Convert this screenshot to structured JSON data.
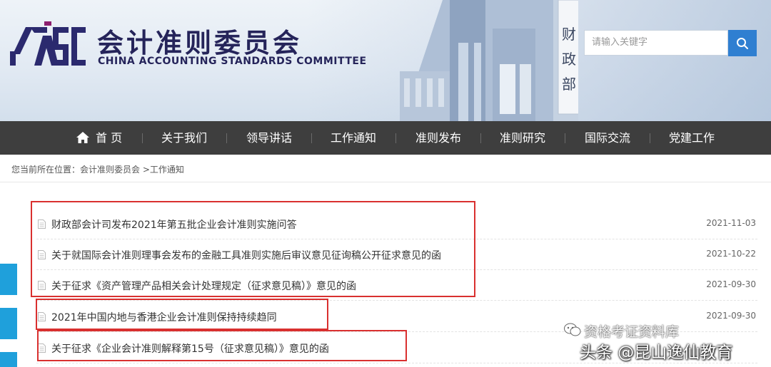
{
  "header": {
    "logo_text": "CASC",
    "title_cn": "会计准则委员会",
    "title_en": "CHINA ACCOUNTING STANDARDS COMMITTEE",
    "building_sign": "财政部"
  },
  "search": {
    "placeholder": "请输入关键字"
  },
  "nav": {
    "items": [
      {
        "label": "首 页"
      },
      {
        "label": "关于我们"
      },
      {
        "label": "领导讲话"
      },
      {
        "label": "工作通知"
      },
      {
        "label": "准则发布"
      },
      {
        "label": "准则研究"
      },
      {
        "label": "国际交流"
      },
      {
        "label": "党建工作"
      }
    ]
  },
  "breadcrumb": {
    "prefix": "您当前所在位置：",
    "items": [
      {
        "label": "会计准则委员会"
      },
      {
        "label": ">工作通知"
      }
    ]
  },
  "news": [
    {
      "title": "财政部会计司发布2021年第五批企业会计准则实施问答",
      "date": "2021-11-03"
    },
    {
      "title": "关于就国际会计准则理事会发布的金融工具准则实施后审议意见征询稿公开征求意见的函",
      "date": "2021-10-22"
    },
    {
      "title": "关于征求《资产管理产品相关会计处理规定（征求意见稿）》意见的函",
      "date": "2021-09-30"
    },
    {
      "title": "2021年中国内地与香港企业会计准则保持持续趋同",
      "date": "2021-09-30"
    },
    {
      "title": "关于征求《企业会计准则解释第15号（征求意见稿）》意见的函",
      "date": ""
    }
  ],
  "watermark": {
    "line1": "资格考证资料库",
    "line2": "头条 @昆山逸仙教育"
  },
  "colors": {
    "brand": "#25245a",
    "nav_bg": "#3e3e3e",
    "search_button": "#2f7fd1",
    "highlight_box": "#d9302f",
    "side_tab": "#1fa0db"
  },
  "icons": [
    "home-icon",
    "search-icon",
    "document-icon",
    "wechat-icon"
  ]
}
